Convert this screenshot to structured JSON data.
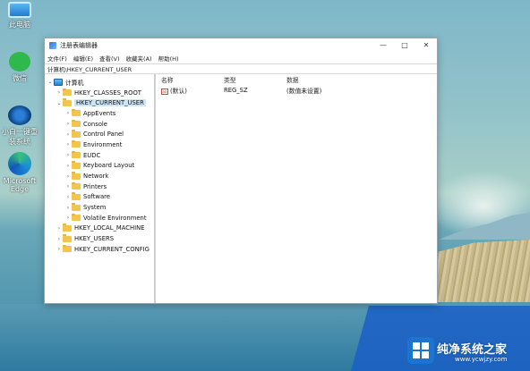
{
  "desktop": {
    "icons": [
      {
        "label": "此电脑"
      },
      {
        "label": "微信"
      },
      {
        "label": "小白一键重装系统"
      },
      {
        "label": "Microsoft Edge"
      }
    ]
  },
  "window": {
    "title": "注册表编辑器",
    "controls": {
      "minimize": "—",
      "maximize": "□",
      "close": "✕"
    },
    "menu": [
      "文件(F)",
      "编辑(E)",
      "查看(V)",
      "收藏夹(A)",
      "帮助(H)"
    ],
    "address": "计算机\\HKEY_CURRENT_USER",
    "tree": [
      {
        "label": "计算机",
        "level": 0,
        "expanded": true,
        "type": "computer"
      },
      {
        "label": "HKEY_CLASSES_ROOT",
        "level": 1,
        "expanded": false
      },
      {
        "label": "HKEY_CURRENT_USER",
        "level": 1,
        "expanded": true,
        "selected": true
      },
      {
        "label": "AppEvents",
        "level": 2,
        "expanded": false
      },
      {
        "label": "Console",
        "level": 2,
        "expanded": false
      },
      {
        "label": "Control Panel",
        "level": 2,
        "expanded": false
      },
      {
        "label": "Environment",
        "level": 2,
        "expanded": false
      },
      {
        "label": "EUDC",
        "level": 2,
        "expanded": false
      },
      {
        "label": "Keyboard Layout",
        "level": 2,
        "expanded": false
      },
      {
        "label": "Network",
        "level": 2,
        "expanded": false
      },
      {
        "label": "Printers",
        "level": 2,
        "expanded": false
      },
      {
        "label": "Software",
        "level": 2,
        "expanded": false
      },
      {
        "label": "System",
        "level": 2,
        "expanded": false
      },
      {
        "label": "Volatile Environment",
        "level": 2,
        "expanded": false
      },
      {
        "label": "HKEY_LOCAL_MACHINE",
        "level": 1,
        "expanded": false
      },
      {
        "label": "HKEY_USERS",
        "level": 1,
        "expanded": false
      },
      {
        "label": "HKEY_CURRENT_CONFIG",
        "level": 1,
        "expanded": false
      }
    ],
    "values": {
      "headers": {
        "name": "名称",
        "type": "类型",
        "data": "数据"
      },
      "rows": [
        {
          "icon": "ab",
          "name": "(默认)",
          "type": "REG_SZ",
          "data": "(数值未设置)"
        }
      ]
    }
  },
  "watermark": {
    "text": "纯净系统之家",
    "url": "www.ycwjzy.com"
  },
  "colors": {
    "folder": "#f3c54b",
    "selection": "#cde6f7",
    "accent": "#1b75d0"
  }
}
